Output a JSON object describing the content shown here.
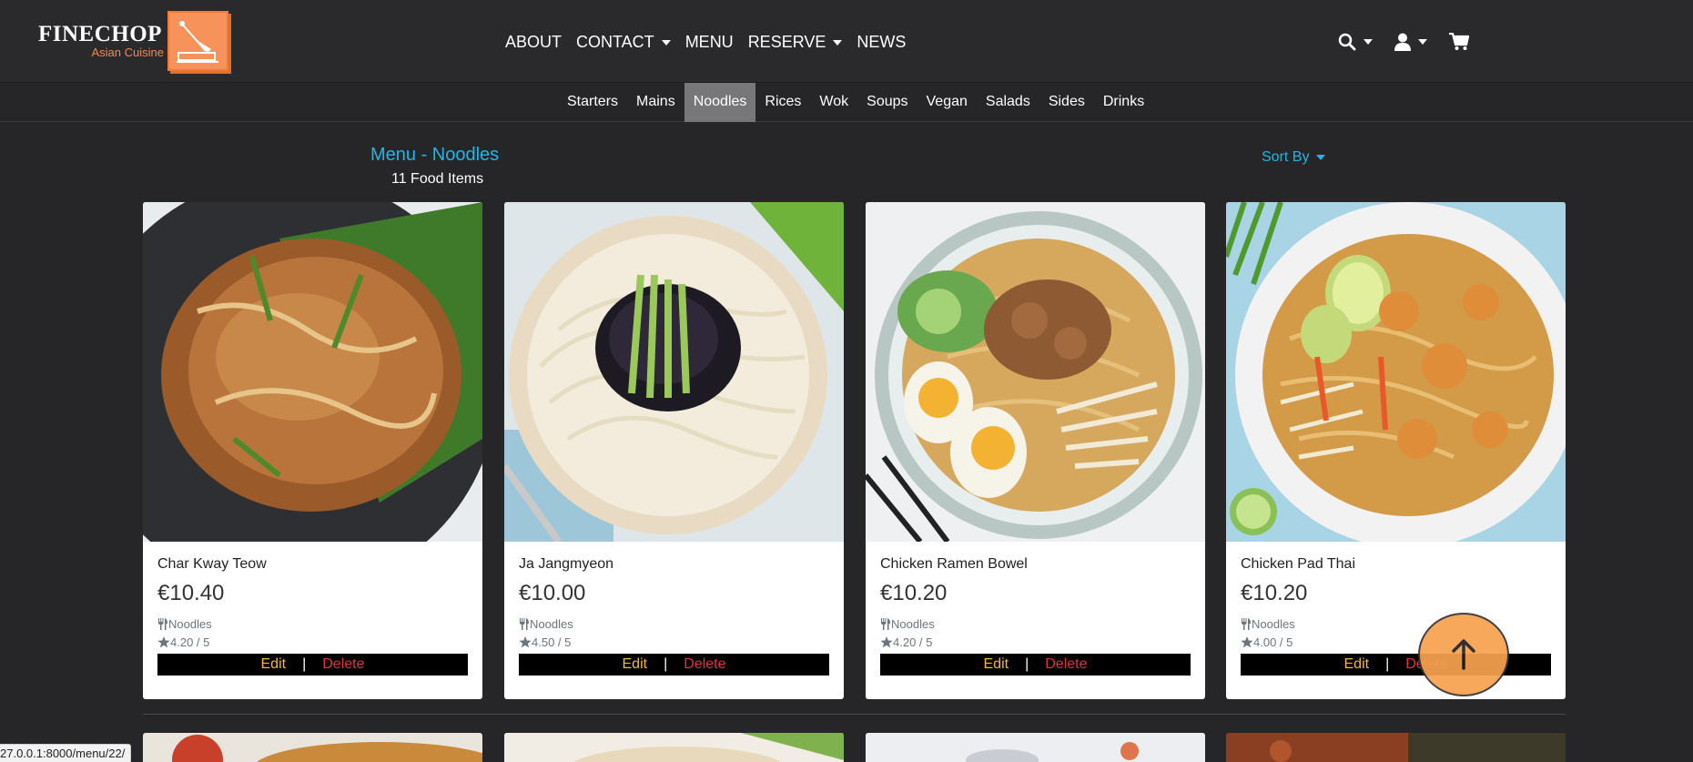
{
  "brand": {
    "name": "FINECHOP",
    "tagline": "Asian Cuisine"
  },
  "nav": {
    "items": [
      {
        "label": "ABOUT",
        "dropdown": false
      },
      {
        "label": "CONTACT",
        "dropdown": true
      },
      {
        "label": "MENU",
        "dropdown": false
      },
      {
        "label": "RESERVE",
        "dropdown": true
      },
      {
        "label": "NEWS",
        "dropdown": false
      }
    ],
    "tools": [
      "search-icon",
      "user-icon",
      "cart-icon"
    ]
  },
  "categories": [
    "Starters",
    "Mains",
    "Noodles",
    "Rices",
    "Wok",
    "Soups",
    "Vegan",
    "Salads",
    "Sides",
    "Drinks"
  ],
  "active_category": "Noodles",
  "page": {
    "heading": "Menu - Noodles",
    "count": "11 Food Items",
    "sort_label": "Sort By"
  },
  "items": [
    {
      "name": "Char Kway Teow",
      "price": "€10.40",
      "category": "Noodles",
      "rating": "4.20 / 5"
    },
    {
      "name": "Ja Jangmyeon",
      "price": "€10.00",
      "category": "Noodles",
      "rating": "4.50 / 5"
    },
    {
      "name": "Chicken Ramen Bowel",
      "price": "€10.20",
      "category": "Noodles",
      "rating": "4.20 / 5"
    },
    {
      "name": "Chicken Pad Thai",
      "price": "€10.20",
      "category": "Noodles",
      "rating": "4.00 / 5"
    }
  ],
  "actions": {
    "edit": "Edit",
    "separator": "|",
    "delete": "Delete"
  },
  "status_url": "27.0.0.1:8000/menu/22/",
  "colors": {
    "accent": "#1fb6e6",
    "brand": "#f7935a",
    "edit": "#f5b82e",
    "delete": "#e0323e"
  }
}
